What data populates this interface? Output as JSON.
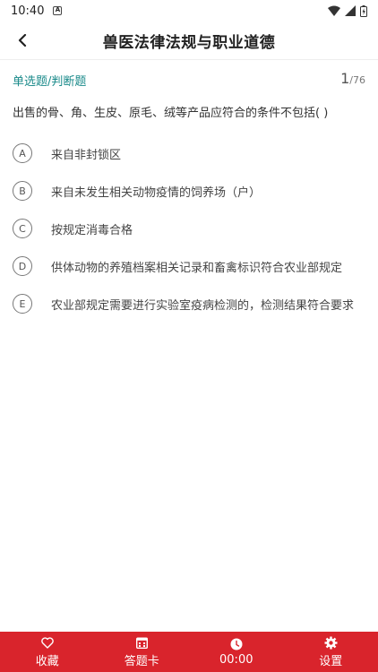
{
  "status": {
    "time": "10:40",
    "notif_glyph": "A"
  },
  "header": {
    "title": "兽医法律法规与职业道德"
  },
  "question": {
    "type": "单选题/判断题",
    "current": "1",
    "total": "/76",
    "text": "出售的骨、角、生皮、原毛、绒等产品应符合的条件不包括( )",
    "options": [
      {
        "letter": "A",
        "text": "来自非封锁区"
      },
      {
        "letter": "B",
        "text": "来自未发生相关动物疫情的饲养场（户）"
      },
      {
        "letter": "C",
        "text": "按规定消毒合格"
      },
      {
        "letter": "D",
        "text": "供体动物的养殖档案相关记录和畜禽标识符合农业部规定"
      },
      {
        "letter": "E",
        "text": "农业部规定需要进行实验室疫病检测的，检测结果符合要求"
      }
    ]
  },
  "bottom_nav": {
    "favorite": "收藏",
    "answer_card": "答题卡",
    "timer": "00:00",
    "settings": "设置"
  },
  "colors": {
    "accent": "#d9242c",
    "qtype": "#1a8a8a"
  },
  "icons": [
    "wifi-icon",
    "signal-icon",
    "battery-icon",
    "back-arrow-icon",
    "heart-icon",
    "calendar-icon",
    "clock-icon",
    "gear-icon"
  ]
}
